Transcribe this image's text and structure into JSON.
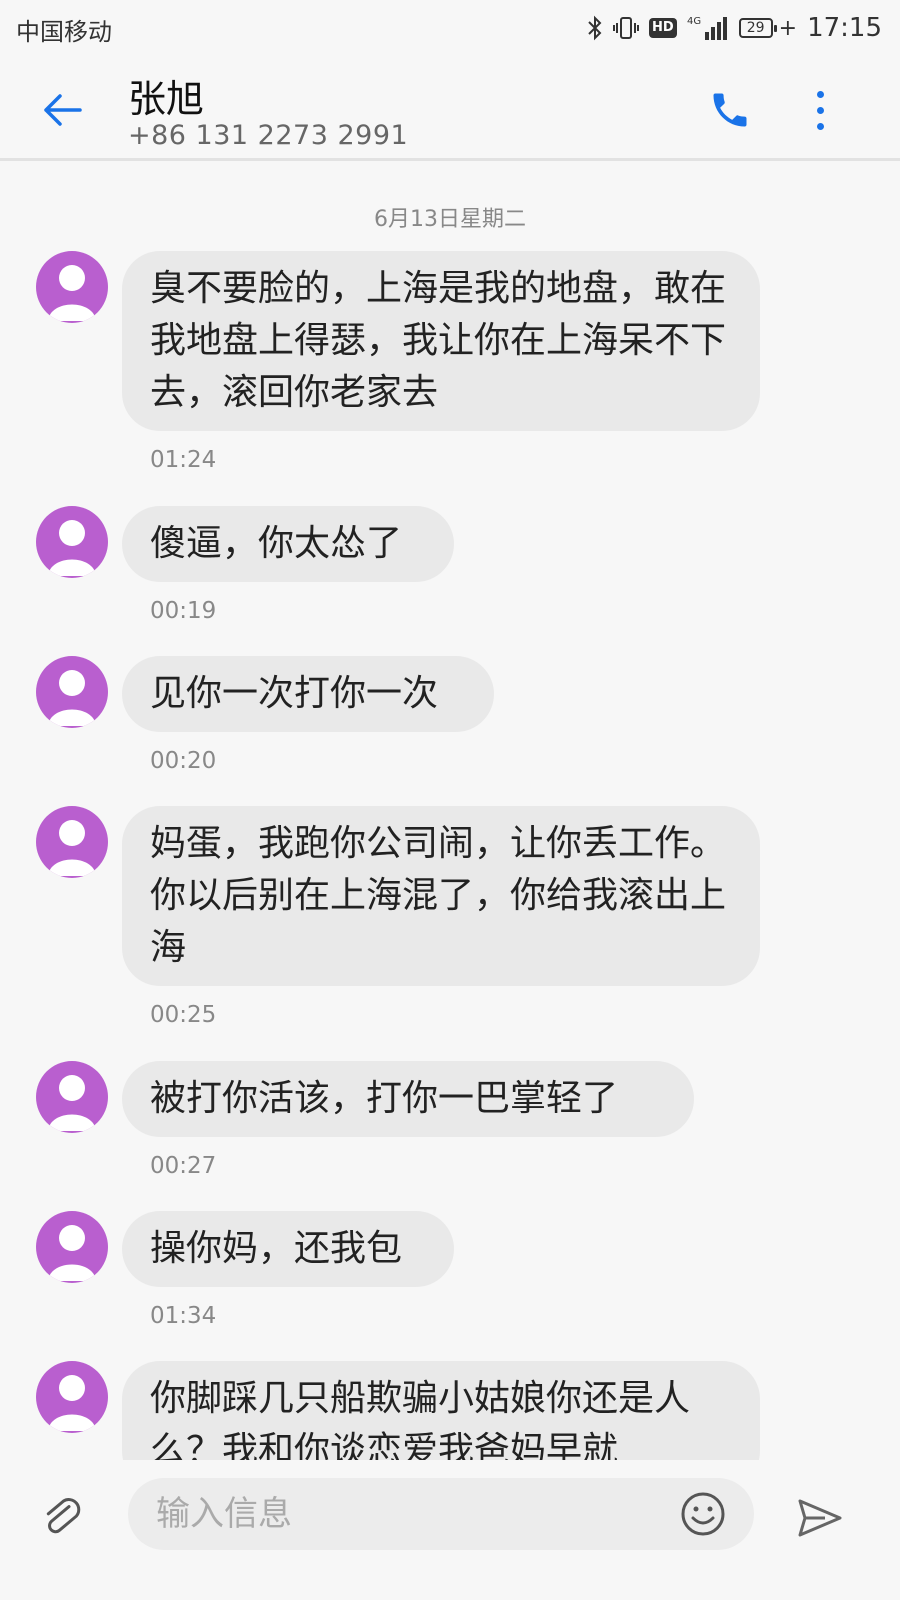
{
  "status_bar": {
    "carrier": "中国移动",
    "network": "4G",
    "hd": "HD",
    "battery": "29",
    "charging": "+",
    "time": "17:15"
  },
  "header": {
    "contact_name": "张旭",
    "contact_phone": "+86 131 2273 2991",
    "accent_color": "#1a73e8"
  },
  "conversation": {
    "date_separator": "6月13日星期二",
    "messages": [
      {
        "text": "臭不要脸的，上海是我的地盘，敢在我地盘上得瑟，我让你在上海呆不下去，滚回你老家去",
        "time": "01:24"
      },
      {
        "text": "傻逼，你太怂了",
        "time": "00:19"
      },
      {
        "text": "见你一次打你一次",
        "time": "00:20"
      },
      {
        "text": "妈蛋，我跑你公司闹，让你丢工作。你以后别在上海混了，你给我滚出上海",
        "time": "00:25"
      },
      {
        "text": "被打你活该，打你一巴掌轻了",
        "time": "00:27"
      },
      {
        "text": "操你妈，还我包",
        "time": "01:34"
      },
      {
        "text": "你脚踩几只船欺骗小姑娘你还是人么？我和你谈恋爱我爸妈早就",
        "time": ""
      }
    ]
  },
  "input_bar": {
    "placeholder": "输入信息"
  },
  "icons": {
    "back": "back-arrow-icon",
    "call": "phone-icon",
    "more": "more-vert-icon",
    "attach": "paperclip-icon",
    "emoji": "smiley-icon",
    "send": "send-icon"
  }
}
